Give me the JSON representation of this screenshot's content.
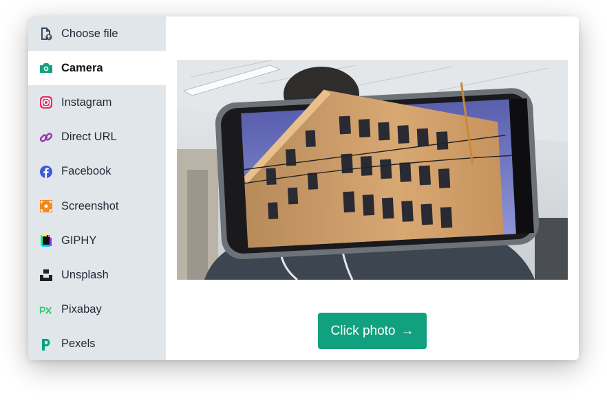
{
  "sidebar": {
    "items": [
      {
        "label": "Choose file",
        "icon": "file-upload-icon"
      },
      {
        "label": "Camera",
        "icon": "camera-icon"
      },
      {
        "label": "Instagram",
        "icon": "instagram-icon"
      },
      {
        "label": "Direct URL",
        "icon": "link-icon"
      },
      {
        "label": "Facebook",
        "icon": "facebook-icon"
      },
      {
        "label": "Screenshot",
        "icon": "screenshot-icon"
      },
      {
        "label": "GIPHY",
        "icon": "giphy-icon"
      },
      {
        "label": "Unsplash",
        "icon": "unsplash-icon"
      },
      {
        "label": "Pixabay",
        "icon": "pixabay-icon"
      },
      {
        "label": "Pexels",
        "icon": "pexels-icon"
      }
    ],
    "active_index": 1
  },
  "main": {
    "click_photo_label": "Click photo",
    "click_photo_arrow": "→"
  },
  "colors": {
    "accent": "#12a17e",
    "sidebar_bg": "#e0e6ea"
  }
}
